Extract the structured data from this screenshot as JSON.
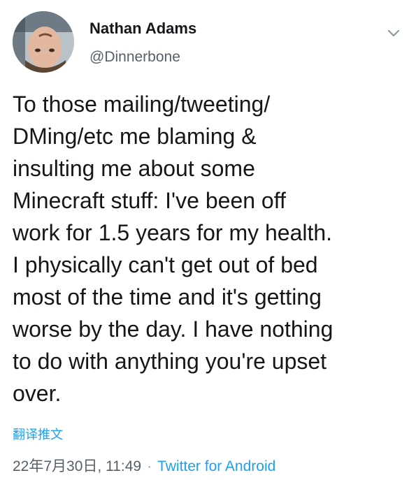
{
  "tweet": {
    "author_name": "Nathan Adams",
    "author_handle": "@Dinnerbone",
    "text": "To those mailing/tweeting/\nDMing/etc me blaming &\ninsulting me about some\nMinecraft stuff: I've been off\nwork for 1.5 years for my health.\nI physically can't get out of bed\nmost of the time and it's getting\nworse by the day. I have nothing\nto do with anything you're upset\nover.",
    "translate_label": "翻译推文",
    "timestamp": "22年7月30日, 11:49",
    "separator": "·",
    "source": "Twitter for Android"
  },
  "icons": {
    "avatar": "profile-photo",
    "menu": "chevron-down-icon"
  },
  "colors": {
    "link": "#1da1f2",
    "secondary_text": "#555f69",
    "primary_text": "#14171a"
  }
}
